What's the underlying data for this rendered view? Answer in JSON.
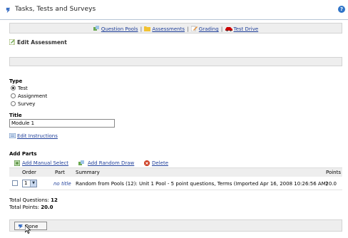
{
  "header": {
    "title": "Tasks, Tests and Surveys",
    "help_symbol": "?"
  },
  "nav": {
    "items": [
      {
        "label": "Question Pools",
        "icon": "question-pools-icon"
      },
      {
        "label": "Assessments",
        "icon": "assessments-folder-icon"
      },
      {
        "label": "Grading",
        "icon": "grading-pencil-icon"
      },
      {
        "label": "Test Drive",
        "icon": "test-drive-car-icon"
      }
    ],
    "separator": "|"
  },
  "page": {
    "heading": "Edit Assessment"
  },
  "type": {
    "label": "Type",
    "options": [
      "Test",
      "Assignment",
      "Survey"
    ],
    "selected": "Test"
  },
  "title_field": {
    "label": "Title",
    "value": "Module 1"
  },
  "edit_instructions": "Edit Instructions",
  "parts": {
    "label": "Add Parts",
    "actions": {
      "manual": "Add Manual Select",
      "random": "Add Random Draw",
      "delete": "Delete"
    },
    "columns": {
      "order": "Order",
      "part": "Part",
      "summary": "Summary",
      "points": "Points"
    },
    "rows": [
      {
        "order": "1",
        "part": "no title",
        "summary": "Random from Pools (12): Unit 1 Pool - 5 point questions, Terms (Imported Apr 16, 2008 10:26:56 AM)",
        "points": "20.0"
      }
    ]
  },
  "totals": {
    "questions_label": "Total Questions:",
    "questions_value": "12",
    "points_label": "Total Points:",
    "points_value": "20.0"
  },
  "footer": {
    "done_label": "Done"
  }
}
